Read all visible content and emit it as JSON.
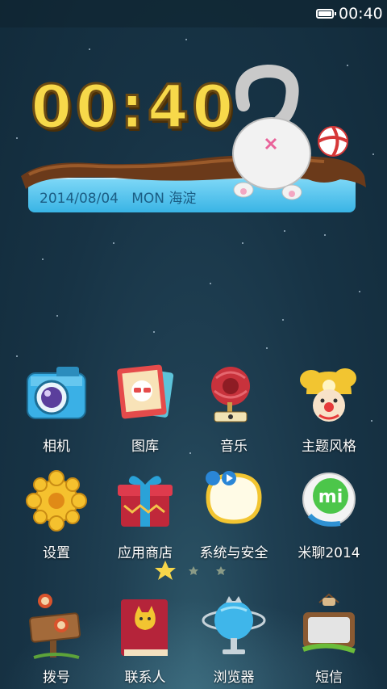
{
  "status_bar": {
    "time": "00:40",
    "battery_icon": "battery-full-icon"
  },
  "clock_widget": {
    "time": "00:40",
    "date": "2014/08/04",
    "weekday": "MON",
    "location": "海淀"
  },
  "apps": [
    {
      "label": "相机",
      "icon": "camera-icon"
    },
    {
      "label": "图库",
      "icon": "gallery-icon"
    },
    {
      "label": "音乐",
      "icon": "music-icon"
    },
    {
      "label": "主题风格",
      "icon": "themes-icon"
    },
    {
      "label": "设置",
      "icon": "settings-gear-icon"
    },
    {
      "label": "应用商店",
      "icon": "app-store-gift-icon"
    },
    {
      "label": "系统与安全",
      "icon": "security-icon"
    },
    {
      "label": "米聊2014",
      "icon": "miliao-icon"
    }
  ],
  "page_indicator": {
    "pages": 3,
    "current": 1
  },
  "dock": [
    {
      "label": "拨号",
      "icon": "dialer-icon"
    },
    {
      "label": "联系人",
      "icon": "contacts-icon"
    },
    {
      "label": "浏览器",
      "icon": "browser-icon"
    },
    {
      "label": "短信",
      "icon": "messages-icon"
    }
  ],
  "colors": {
    "clock_yellow": "#f7d94a",
    "date_bar": "#39b4e5",
    "background": "#173345"
  }
}
